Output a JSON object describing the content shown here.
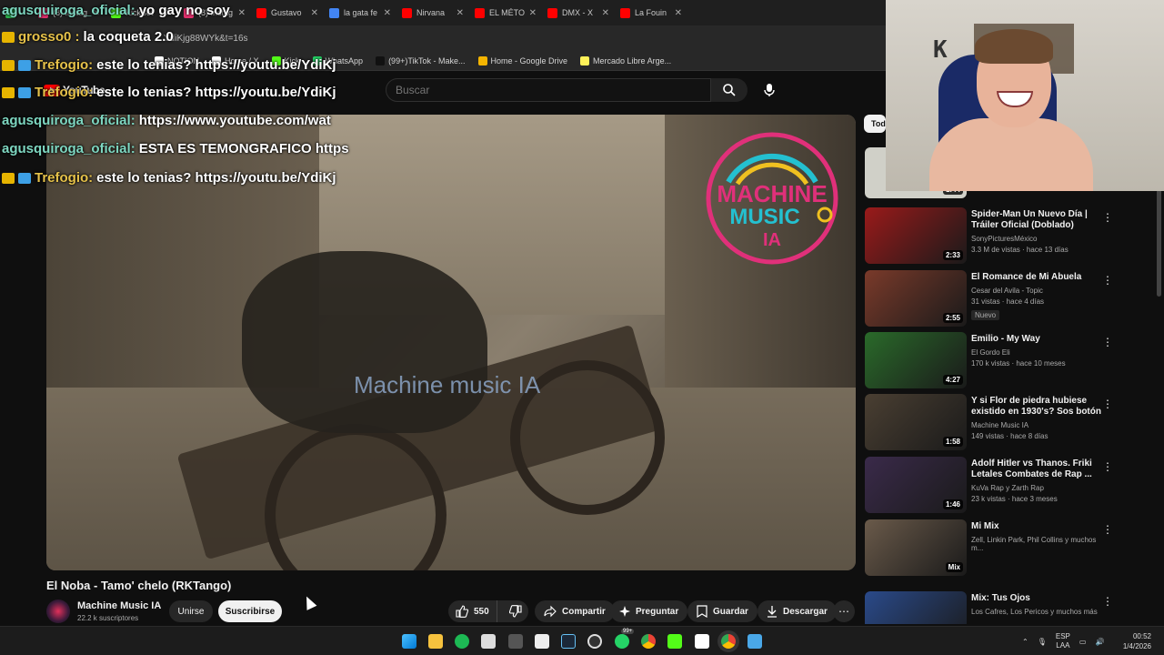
{
  "browser": {
    "tabs": [
      {
        "label": "",
        "color": "#2bb24c"
      },
      {
        "label": "(8) Instag",
        "color": "#e1306c"
      },
      {
        "label": "KickBot",
        "color": "#53fc18"
      },
      {
        "label": "(8) Instag",
        "color": "#e1306c"
      },
      {
        "label": "Gustavo",
        "color": "#ff0000"
      },
      {
        "label": "la gata fe",
        "color": "#4285f4"
      },
      {
        "label": "Nirvana",
        "color": "#ff0000"
      },
      {
        "label": "EL MÉTO",
        "color": "#ff0000"
      },
      {
        "label": "DMX - X",
        "color": "#ff0000"
      },
      {
        "label": "La Fouin",
        "color": "#ff0000"
      }
    ],
    "url_fragment": "YdiKjg88WYk&t=16s",
    "bookmarks": [
      {
        "label": "NOTION",
        "color": "#ffffff"
      },
      {
        "label": "Home / X",
        "color": "#ffffff"
      },
      {
        "label": "Kick",
        "color": "#53fc18"
      },
      {
        "label": "WhatsApp",
        "color": "#25d366"
      },
      {
        "label": "(99+)TikTok - Make...",
        "color": "#111111"
      },
      {
        "label": "Home - Google Drive",
        "color": "#f4b400"
      },
      {
        "label": "Mercado Libre Arge...",
        "color": "#fff159"
      }
    ]
  },
  "youtube": {
    "logo_text": "YouTube",
    "search_placeholder": "Buscar"
  },
  "chat": [
    {
      "user": "agusquiroga_oficial:",
      "msg": "yo gay no soy",
      "badge": "none",
      "user_color": "teal"
    },
    {
      "user": "grosso0 :",
      "msg": "la coqueta 2.0",
      "badge": "crown",
      "user_color": "gold"
    },
    {
      "user": "Trefogio:",
      "msg": "este lo tenias? https://youtu.be/YdiKj",
      "badge": "crown",
      "user_color": "gold"
    },
    {
      "user": "Trefogio:",
      "msg": "este lo tenias? https://youtu.be/YdiKj",
      "badge": "crown",
      "user_color": "gold"
    },
    {
      "user": "agusquiroga_oficial:",
      "msg": "https://www.youtube.com/wat",
      "badge": "none",
      "user_color": "teal"
    },
    {
      "user": "agusquiroga_oficial:",
      "msg": "ESTA ES TEMONGRAFICO https",
      "badge": "none",
      "user_color": "teal"
    },
    {
      "user": "Trefogio:",
      "msg": "este lo tenias? https://youtu.be/YdiKj",
      "badge": "crown",
      "user_color": "gold"
    }
  ],
  "video": {
    "watermark": "Machine music IA",
    "logo_line1": "MACHINE",
    "logo_line2": "MUSIC",
    "logo_line3": "IA",
    "title": "El Noba - Tamo' chelo (RKTango)",
    "channel": "Machine Music IA",
    "subscribers": "22.2 k suscriptores",
    "join_label": "Unirse",
    "subscribe_label": "Suscribirse",
    "likes": "550",
    "share_label": "Compartir",
    "ask_label": "Preguntar",
    "save_label": "Guardar",
    "download_label": "Descargar"
  },
  "sidebar": {
    "chip_all": "Tod",
    "first_duration": "1:44",
    "items": [
      {
        "title": "Spider-Man Un Nuevo Día | Tráiler Oficial (Doblado)",
        "channel": "SonyPicturesMéxico",
        "meta": "3.3 M de vistas · hace 13 días",
        "duration": "2:33",
        "badge": "",
        "thumb": "#9a1a1a"
      },
      {
        "title": "El Romance de Mi Abuela",
        "channel": "Cesar del Avila - Topic",
        "meta": "31 vistas · hace 4 días",
        "duration": "2:55",
        "badge": "Nuevo",
        "thumb": "#7a3a2a"
      },
      {
        "title": "Emilio - My Way",
        "channel": "El Gordo Eli",
        "meta": "170 k vistas · hace 10 meses",
        "duration": "4:27",
        "badge": "",
        "thumb": "#2a6a2a"
      },
      {
        "title": "Y si Flor de piedra hubiese existido en 1930's? Sos botón ...",
        "channel": "Machine Music IA",
        "meta": "149 vistas · hace 8 días",
        "duration": "1:58",
        "badge": "",
        "thumb": "#4a3f32"
      },
      {
        "title": "Adolf Hitler vs Thanos. Friki Letales Combates de Rap ...",
        "channel": "KuVa Rap y Zarth Rap",
        "meta": "23 k vistas · hace 3 meses",
        "duration": "1:46",
        "badge": "",
        "thumb": "#3a2a4a"
      },
      {
        "title": "Mi Mix",
        "channel": "Zell, Linkin Park, Phil Collins y muchos m...",
        "meta": "",
        "duration": "Mix",
        "badge": "",
        "thumb": "#6a5a4a"
      },
      {
        "title": "Mix: Tus Ojos",
        "channel": "Los Cafres, Los Pericos y muchos más",
        "meta": "",
        "duration": "",
        "badge": "",
        "thumb": "#2a4a8a"
      }
    ]
  },
  "webcam": {
    "letter": "K"
  },
  "taskbar": {
    "lang_top": "ESP",
    "lang_bottom": "LAA",
    "time": "00:52",
    "date": "1/4/2026",
    "badge_count": "99+"
  }
}
